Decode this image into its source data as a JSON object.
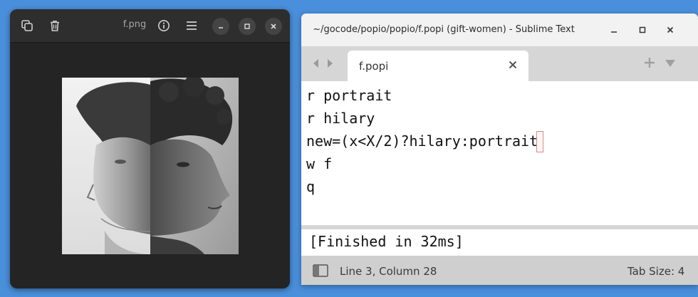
{
  "viewer": {
    "title": "f.png",
    "image_alt": "composite portrait: left half portrait, right half hilary"
  },
  "sublime": {
    "title": "~/gocode/popio/popio/f.popi (gift-women) - Sublime Text",
    "tab_label": "f.popi",
    "code_lines": [
      "r portrait",
      "r hilary",
      "new=(x<X/2)?hilary:portrait",
      "w f",
      "q"
    ],
    "output": "[Finished in 32ms]",
    "status": {
      "position": "Line 3, Column 28",
      "tab_size": "Tab Size: 4"
    }
  }
}
